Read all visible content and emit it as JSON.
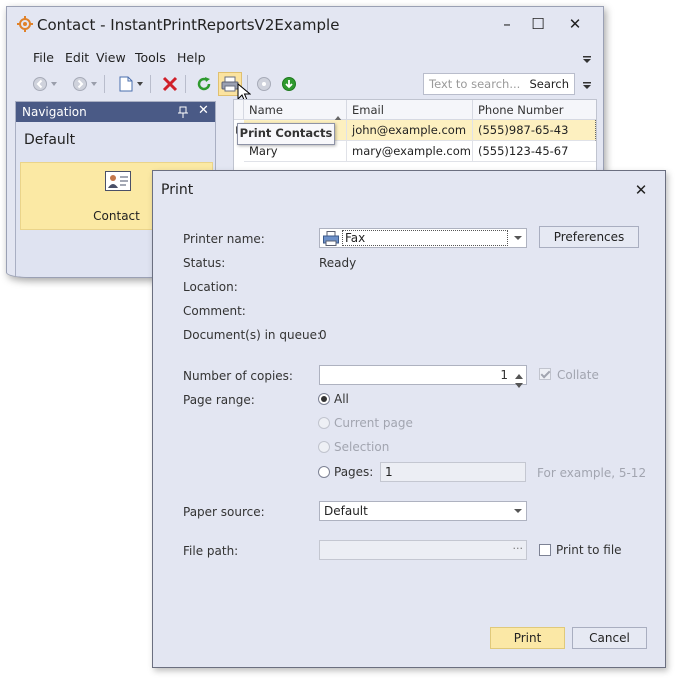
{
  "window": {
    "title": "Contact - InstantPrintReportsV2Example",
    "controls": {
      "minimize": "–",
      "maximize": "☐",
      "close": "✕"
    }
  },
  "menu": {
    "items": [
      "File",
      "Edit",
      "View",
      "Tools",
      "Help"
    ]
  },
  "search": {
    "placeholder": "Text to search...",
    "button": "Search"
  },
  "navigation": {
    "title": "Navigation",
    "group": "Default",
    "items": [
      {
        "label": "Contact"
      }
    ]
  },
  "grid": {
    "columns": [
      "Name",
      "Email",
      "Phone Number"
    ],
    "rows": [
      {
        "name": "",
        "email": "john@example.com",
        "phone": "(555)987-65-43",
        "selected": true
      },
      {
        "name": "Mary",
        "email": "mary@example.com",
        "phone": "(555)123-45-67",
        "selected": false
      }
    ]
  },
  "tooltip": {
    "text": "Print Contacts"
  },
  "dialog": {
    "title": "Print",
    "close": "✕",
    "printer_name_label": "Printer name:",
    "printer_name": "Fax",
    "preferences_button": "Preferences",
    "status_label": "Status:",
    "status": "Ready",
    "location_label": "Location:",
    "comment_label": "Comment:",
    "queue_label": "Document(s) in queue:",
    "queue": "0",
    "copies_label": "Number of copies:",
    "copies": "1",
    "collate_label": "Collate",
    "range_label": "Page range:",
    "range_all": "All",
    "range_current": "Current page",
    "range_selection": "Selection",
    "range_pages": "Pages:",
    "pages_value": "1",
    "pages_hint": "For example, 5-12",
    "paper_source_label": "Paper source:",
    "paper_source": "Default",
    "file_path_label": "File path:",
    "file_path_button": "···",
    "print_to_file_label": "Print to file",
    "print_button": "Print",
    "cancel_button": "Cancel"
  }
}
